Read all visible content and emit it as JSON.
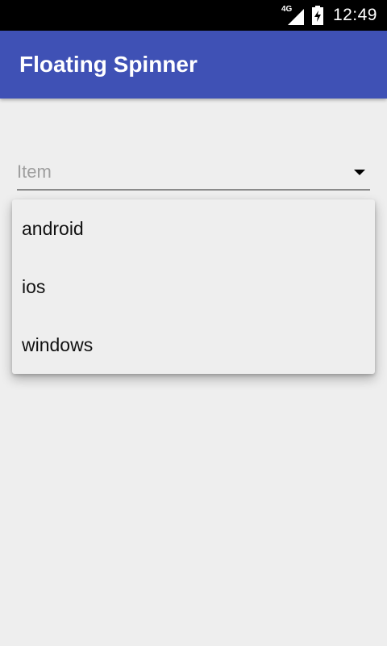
{
  "status_bar": {
    "network_type": "4G",
    "network_icon": "signal-icon",
    "battery_icon": "battery-charging-icon",
    "time": "12:49"
  },
  "app_bar": {
    "title": "Floating Spinner",
    "color": "#3f51b5"
  },
  "spinner": {
    "hint": "Item",
    "arrow_icon": "dropdown-arrow-icon"
  },
  "dropdown": {
    "items": [
      {
        "label": "android"
      },
      {
        "label": "ios"
      },
      {
        "label": "windows"
      }
    ]
  }
}
